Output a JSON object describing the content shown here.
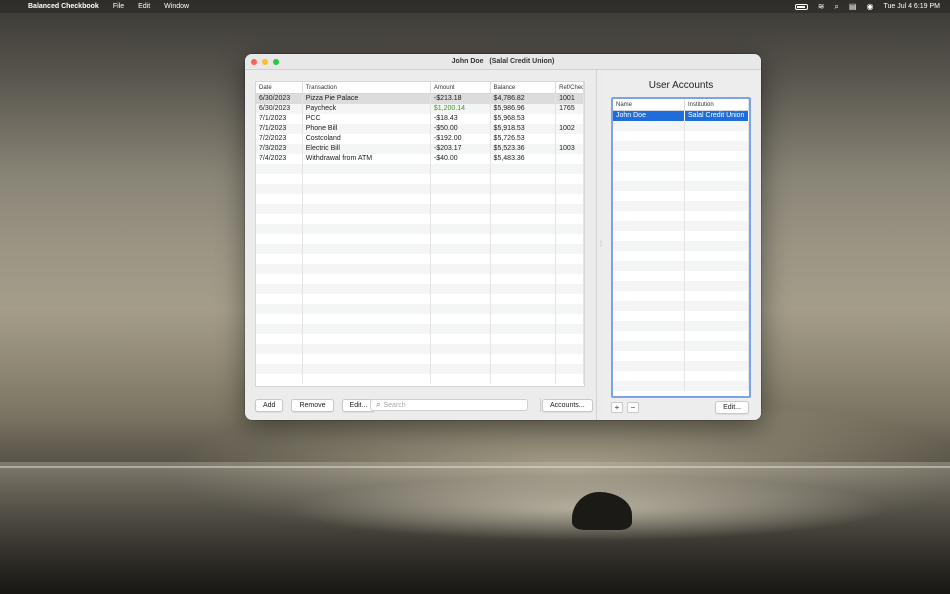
{
  "menubar": {
    "app_name": "Balanced Checkbook",
    "menus": [
      "File",
      "Edit",
      "Window"
    ],
    "clock": "Tue Jul 4  6:19 PM"
  },
  "window": {
    "title": "John Doe   (Salal Credit Union)"
  },
  "transactions": {
    "columns": [
      "Date",
      "Transaction",
      "Amount",
      "Balance",
      "Ref/Chec"
    ],
    "rows": [
      {
        "date": "6/30/2023",
        "transaction": "Pizza Pie Palace",
        "amount": "-$213.18",
        "balance": "$4,786.82",
        "ref": "1001"
      },
      {
        "date": "6/30/2023",
        "transaction": "Paycheck",
        "amount": "$1,200.14",
        "balance": "$5,986.96",
        "ref": "1765"
      },
      {
        "date": "7/1/2023",
        "transaction": "PCC",
        "amount": "-$18.43",
        "balance": "$5,968.53",
        "ref": ""
      },
      {
        "date": "7/1/2023",
        "transaction": "Phone Bill",
        "amount": "-$50.00",
        "balance": "$5,918.53",
        "ref": "1002"
      },
      {
        "date": "7/2/2023",
        "transaction": "Costcoland",
        "amount": "-$192.00",
        "balance": "$5,726.53",
        "ref": ""
      },
      {
        "date": "7/3/2023",
        "transaction": "Electric Bill",
        "amount": "-$203.17",
        "balance": "$5,523.36",
        "ref": "1003"
      },
      {
        "date": "7/4/2023",
        "transaction": "Withdrawal from ATM",
        "amount": "-$40.00",
        "balance": "$5,483.36",
        "ref": ""
      }
    ]
  },
  "toolbar": {
    "add_label": "Add",
    "remove_label": "Remove",
    "edit_label": "Edit...",
    "search_placeholder": "Search",
    "accounts_label": "Accounts..."
  },
  "user_accounts": {
    "title": "User Accounts",
    "columns": [
      "Name",
      "Institution"
    ],
    "rows": [
      {
        "name": "John Doe",
        "institution": "Salal Credit Union"
      }
    ],
    "add_label": "+",
    "remove_label": "−",
    "edit_label": "Edit..."
  },
  "colors": {
    "selection_blue": "#1f6ddb",
    "positive_amount": "#3a9a2a",
    "focus_ring": "#7ba3e8"
  }
}
